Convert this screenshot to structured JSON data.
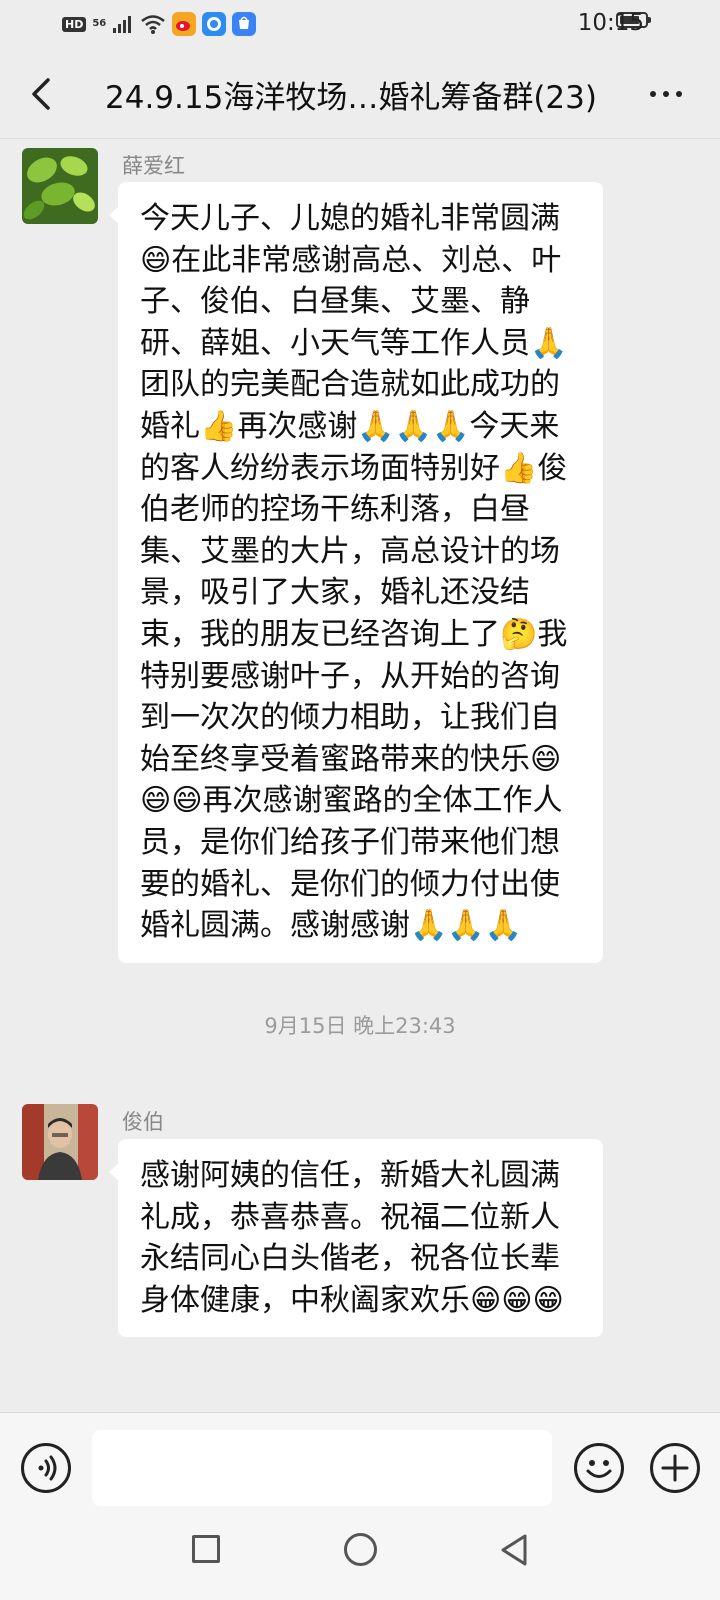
{
  "status_bar": {
    "network_hd": "HD",
    "network_56": "56",
    "time": "10:15",
    "battery_level": 0.8
  },
  "header": {
    "title": "24.9.15海洋牧场…婚礼筹备群(23)",
    "back_icon": "back-chevron-icon",
    "more_icon": "more-dots-icon"
  },
  "messages": [
    {
      "sender": "薛爱红",
      "text": "今天儿子、儿媳的婚礼非常圆满😄在此非常感谢高总、刘总、叶子、俊伯、白昼集、艾墨、静研、薛姐、小天气等工作人员🙏团队的完美配合造就如此成功的婚礼👍再次感谢🙏🙏🙏今天来的客人纷纷表示场面特别好👍俊伯老师的控场干练利落，白昼集、艾墨的大片，高总设计的场景，吸引了大家，婚礼还没结束，我的朋友已经咨询上了🤔我特别要感谢叶子，从开始的咨询到一次次的倾力相助，让我们自始至终享受着蜜路带来的快乐😄😄😄再次感谢蜜路的全体工作人员，是你们给孩子们带来他们想要的婚礼、是你们的倾力付出使婚礼圆满。感谢感谢🙏🙏🙏"
    },
    {
      "sender": "俊伯",
      "text": "感谢阿姨的信任，新婚大礼圆满礼成，恭喜恭喜。祝福二位新人永结同心白头偕老，祝各位长辈身体健康，中秋阖家欢乐😁😁😁"
    }
  ],
  "timestamp": "9月15日 晚上23:43",
  "input_bar": {
    "placeholder": "",
    "voice_icon": "voice-icon",
    "emoji_icon": "emoji-icon",
    "plus_icon": "plus-icon"
  },
  "nav_bar": {
    "recent_icon": "square-icon",
    "home_icon": "circle-icon",
    "back_icon": "triangle-back-icon"
  }
}
